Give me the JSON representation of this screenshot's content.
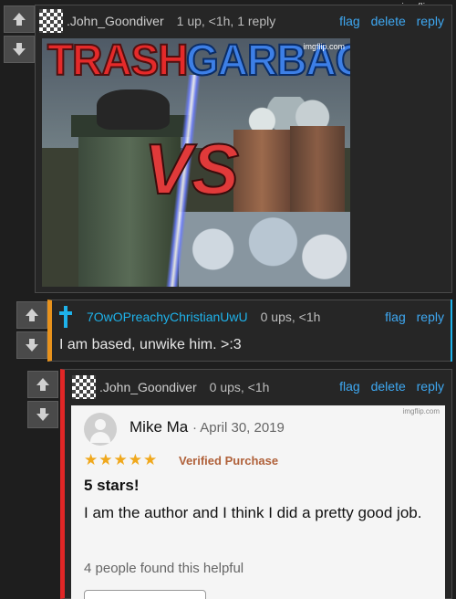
{
  "watermark": "imgflip.com",
  "comments": [
    {
      "username": ".John_Goondiver",
      "meta": "1 up, <1h, 1 reply",
      "actions": [
        "flag",
        "delete",
        "reply"
      ],
      "meme": {
        "left_text": "TRASH",
        "right_text": "GARBAGE",
        "center_text": "VS",
        "watermark": "imgflip.com"
      }
    },
    {
      "username": "7OwOPreachyChristianUwU",
      "meta": "0 ups, <1h",
      "actions": [
        "flag",
        "reply"
      ],
      "body": "I am based, unwike him. >:3"
    },
    {
      "username": ".John_Goondiver",
      "meta": "0 ups, <1h",
      "actions": [
        "flag",
        "delete",
        "reply"
      ],
      "review": {
        "watermark": "imgflip.com",
        "reviewer": "Mike Ma",
        "date": "· April 30, 2019",
        "stars": "★★★★★",
        "rating": 5,
        "verified": "Verified Purchase",
        "title": "5 stars!",
        "body": "I am the author and I think I did a pretty good job.",
        "helpful": "4 people found this helpful"
      }
    }
  ],
  "colors": {
    "link": "#3ea8f2",
    "accent_orange": "#e8921c",
    "accent_blue": "#1eb2ea",
    "accent_red": "#e12626"
  },
  "icons": [
    "up-arrow-icon",
    "down-arrow-icon",
    "cross-icon",
    "checker-avatar-icon"
  ]
}
